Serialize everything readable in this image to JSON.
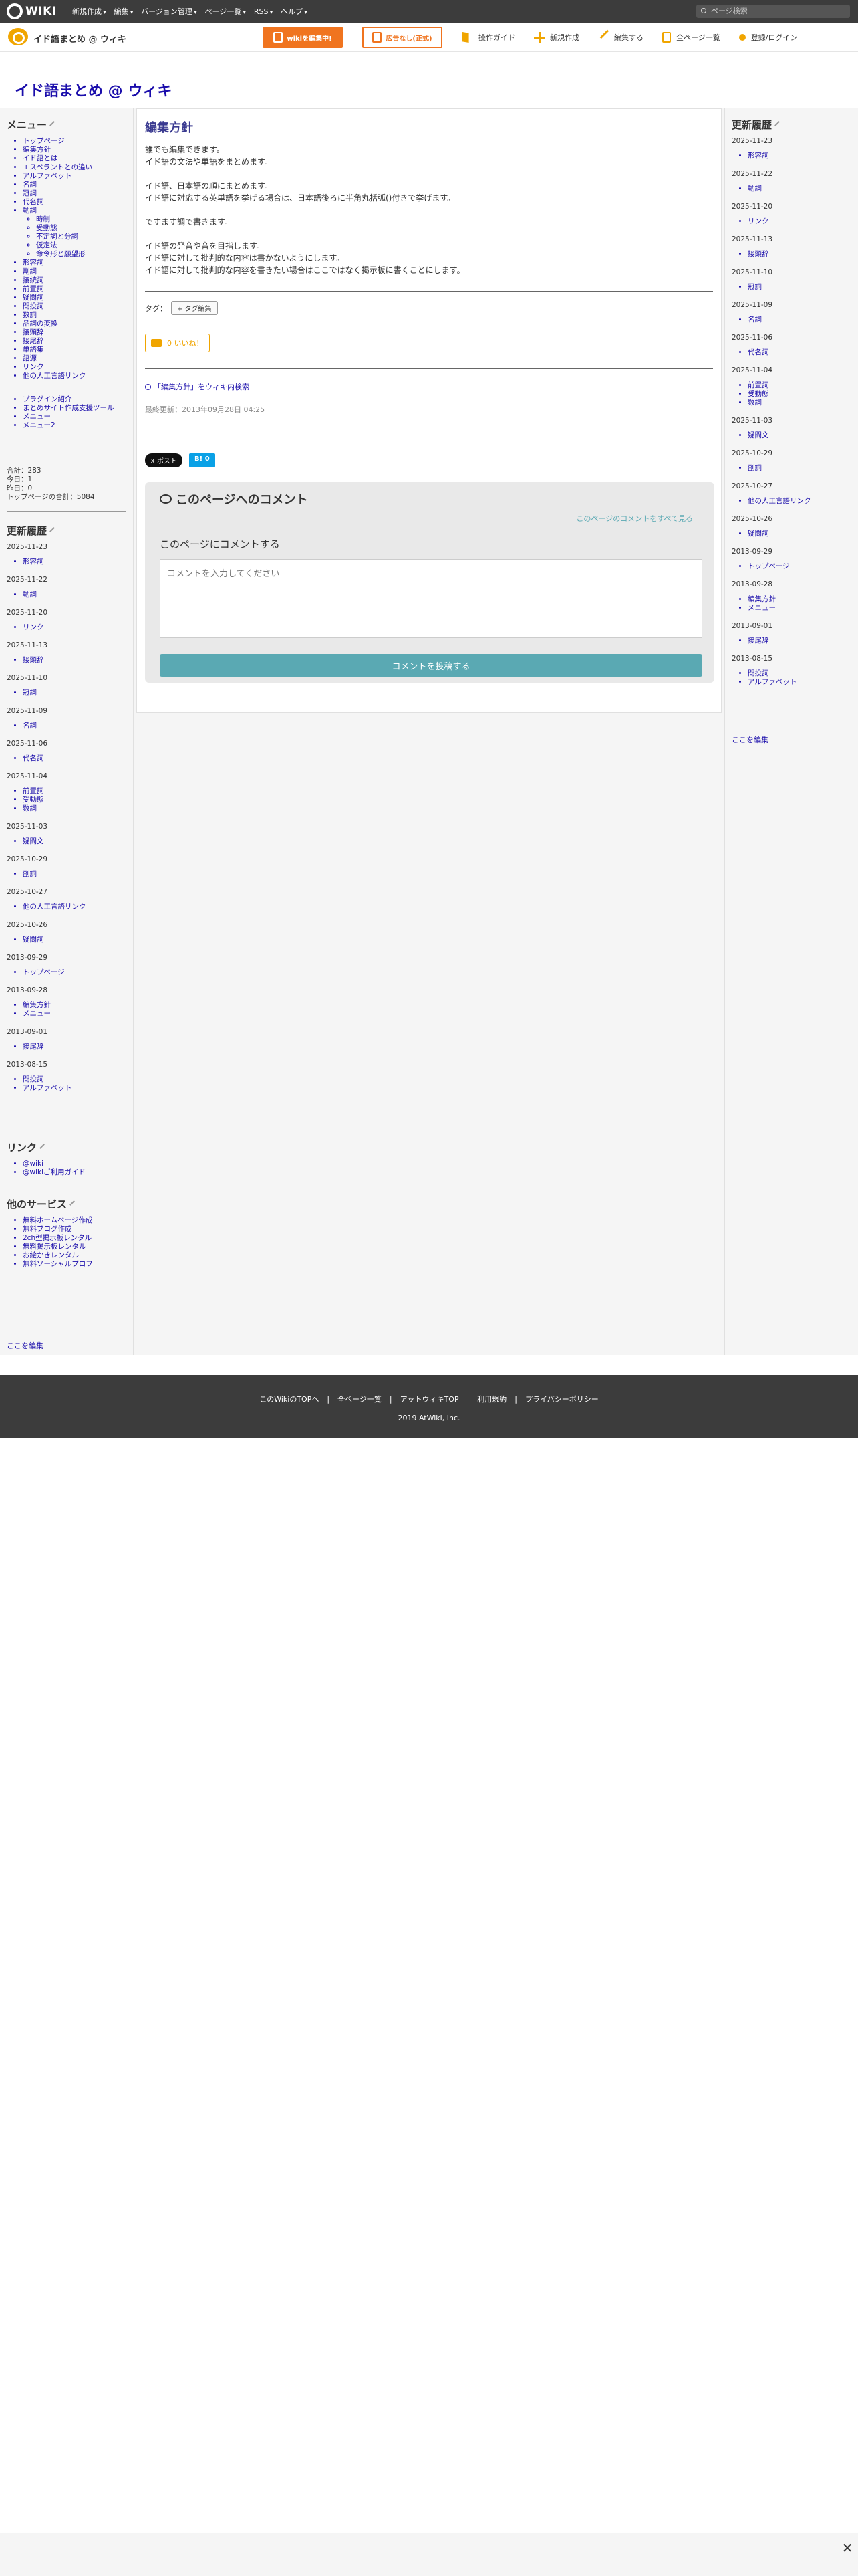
{
  "topbar": {
    "logo_text": "WIKI",
    "menu": [
      "新規作成",
      "編集",
      "バージョン管理",
      "ページ一覧",
      "RSS",
      "ヘルプ"
    ],
    "search_placeholder": "ページ検索"
  },
  "subbar": {
    "wiki_name": "イド語まとめ @ ウィキ",
    "wiki_edit_button": "wikiを編集中!",
    "no_ads_button": "広告なし(正式)",
    "tools": [
      "操作ガイド",
      "新規作成",
      "編集する",
      "全ページ一覧",
      "登録/ログイン"
    ]
  },
  "site_title": "イド語まとめ @ ウィキ",
  "left": {
    "menu_heading": "メニュー",
    "menu_items": [
      "トップページ",
      "編集方針",
      "イド語とは",
      "エスペラントとの違い",
      "アルファベット",
      "名詞",
      "冠詞",
      "代名詞",
      "動詞"
    ],
    "verb_subitems": [
      "時制",
      "受動態",
      "不定詞と分詞",
      "仮定法",
      "命令形と願望形"
    ],
    "menu_items2": [
      "形容詞",
      "副詞",
      "接続詞",
      "前置詞",
      "疑問詞",
      "間投詞",
      "数詞",
      "品詞の変換",
      "接頭辞",
      "接尾辞",
      "単語集",
      "語源",
      "リンク",
      "他の人工言語リンク"
    ],
    "menu_items3": [
      "プラグイン紹介",
      "まとめサイト作成支援ツール",
      "メニュー",
      "メニュー2"
    ],
    "stats": [
      "合計：283",
      "今日：1",
      "昨日：0",
      "トップページの合計：5084"
    ],
    "recent_heading": "更新履歴",
    "recent": [
      {
        "date": "2025-11-23",
        "items": [
          "形容詞"
        ]
      },
      {
        "date": "2025-11-22",
        "items": [
          "動詞"
        ]
      },
      {
        "date": "2025-11-20",
        "items": [
          "リンク"
        ]
      },
      {
        "date": "2025-11-13",
        "items": [
          "接頭辞"
        ]
      },
      {
        "date": "2025-11-10",
        "items": [
          "冠詞"
        ]
      },
      {
        "date": "2025-11-09",
        "items": [
          "名詞"
        ]
      },
      {
        "date": "2025-11-06",
        "items": [
          "代名詞"
        ]
      },
      {
        "date": "2025-11-04",
        "items": [
          "前置詞",
          "受動態",
          "数詞"
        ]
      },
      {
        "date": "2025-11-03",
        "items": [
          "疑問文"
        ]
      },
      {
        "date": "2025-10-29",
        "items": [
          "副詞"
        ]
      },
      {
        "date": "2025-10-27",
        "items": [
          "他の人工言語リンク"
        ]
      },
      {
        "date": "2025-10-26",
        "items": [
          "疑問詞"
        ]
      },
      {
        "date": "2013-09-29",
        "items": [
          "トップページ"
        ]
      },
      {
        "date": "2013-09-28",
        "items": [
          "編集方針",
          "メニュー"
        ]
      },
      {
        "date": "2013-09-01",
        "items": [
          "接尾辞"
        ]
      },
      {
        "date": "2013-08-15",
        "items": [
          "間投詞",
          "アルファベット"
        ]
      }
    ],
    "link_heading": "リンク",
    "links": [
      "@wiki",
      "@wikiご利用ガイド"
    ],
    "services_heading": "他のサービス",
    "services": [
      "無料ホームページ作成",
      "無料ブログ作成",
      "2ch型掲示板レンタル",
      "無料掲示板レンタル",
      "お絵かきレンタル",
      "無料ソーシャルプロフ"
    ],
    "edit_here": "ここを編集"
  },
  "main": {
    "page_title": "編集方針",
    "paragraphs": [
      "誰でも編集できます。",
      "イド語の文法や単語をまとめます。",
      "",
      "イド語、日本語の順にまとめます。",
      "イド語に対応する英単語を挙げる場合は、日本語後ろに半角丸括弧()付きで挙げます。",
      "",
      "ですます調で書きます。",
      "",
      "イド語の発音や音を目指します。",
      "イド語に対して批判的な内容は書かないようにします。",
      "イド語に対して批判的な内容を書きたい場合はここではなく掲示板に書くことにします。"
    ],
    "tag_label": "タグ：",
    "tag_button": "+ タグ編集",
    "like_button": "0 いいね！",
    "search_link": "「編集方針」をウィキ内検索",
    "updated": "最終更新：2013年09月28日 04:25",
    "share_x": "X ポスト",
    "share_hb": "B! 0",
    "comment": {
      "heading": "このページへのコメント",
      "all_link": "このページのコメントをすべて見る",
      "label": "このページにコメントする",
      "placeholder": "コメントを入力してください",
      "submit": "コメントを投稿する"
    }
  },
  "right": {
    "recent_heading": "更新履歴",
    "recent": [
      {
        "date": "2025-11-23",
        "items": [
          "形容詞"
        ]
      },
      {
        "date": "2025-11-22",
        "items": [
          "動詞"
        ]
      },
      {
        "date": "2025-11-20",
        "items": [
          "リンク"
        ]
      },
      {
        "date": "2025-11-13",
        "items": [
          "接頭辞"
        ]
      },
      {
        "date": "2025-11-10",
        "items": [
          "冠詞"
        ]
      },
      {
        "date": "2025-11-09",
        "items": [
          "名詞"
        ]
      },
      {
        "date": "2025-11-06",
        "items": [
          "代名詞"
        ]
      },
      {
        "date": "2025-11-04",
        "items": [
          "前置詞",
          "受動態",
          "数詞"
        ]
      },
      {
        "date": "2025-11-03",
        "items": [
          "疑問文"
        ]
      },
      {
        "date": "2025-10-29",
        "items": [
          "副詞"
        ]
      },
      {
        "date": "2025-10-27",
        "items": [
          "他の人工言語リンク"
        ]
      },
      {
        "date": "2025-10-26",
        "items": [
          "疑問詞"
        ]
      },
      {
        "date": "2013-09-29",
        "items": [
          "トップページ"
        ]
      },
      {
        "date": "2013-09-28",
        "items": [
          "編集方針",
          "メニュー"
        ]
      },
      {
        "date": "2013-09-01",
        "items": [
          "接尾辞"
        ]
      },
      {
        "date": "2013-08-15",
        "items": [
          "間投詞",
          "アルファベット"
        ]
      }
    ],
    "edit_here": "ここを編集"
  },
  "footer": {
    "links": [
      "このWikiのTOPへ",
      "全ページ一覧",
      "アットウィキTOP",
      "利用規約",
      "プライバシーポリシー"
    ],
    "copyright": "2019 AtWiki, Inc."
  },
  "close_label": "✕"
}
